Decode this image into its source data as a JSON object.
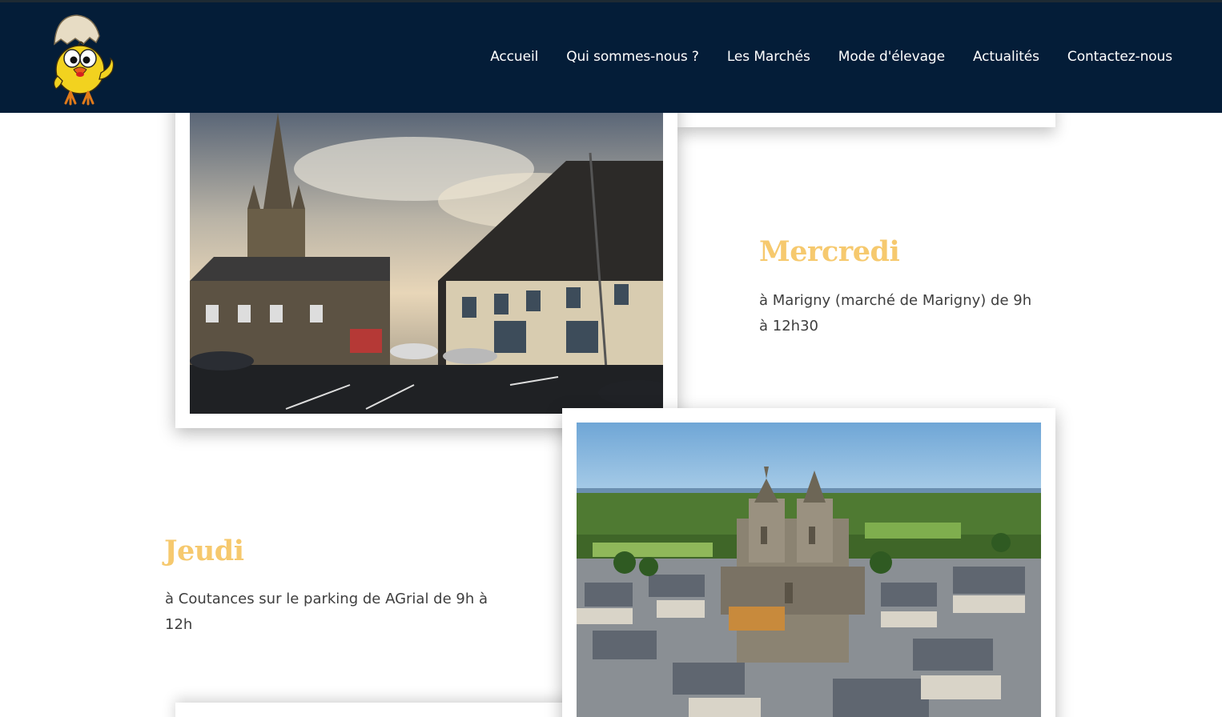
{
  "header": {
    "logo_name": "chick-in-egg-logo",
    "nav": [
      {
        "label": "Accueil"
      },
      {
        "label": "Qui sommes-nous ?"
      },
      {
        "label": "Les Marchés"
      },
      {
        "label": "Mode d'élevage"
      },
      {
        "label": "Actualités"
      },
      {
        "label": "Contactez-nous"
      }
    ],
    "colors": {
      "background": "#041d38",
      "text": "#ffffff"
    }
  },
  "markets": [
    {
      "day": "Mercredi",
      "text": "à Marigny (marché de Marigny) de 9h à 12h30",
      "image": "marigny-town-square-photo"
    },
    {
      "day": "Jeudi",
      "text": "à Coutances sur le parking de AGrial de 9h à 12h",
      "image": "coutances-cathedral-aerial-photo"
    }
  ],
  "colors": {
    "accent": "#f6c96e",
    "body_text": "#3e3e3e"
  }
}
